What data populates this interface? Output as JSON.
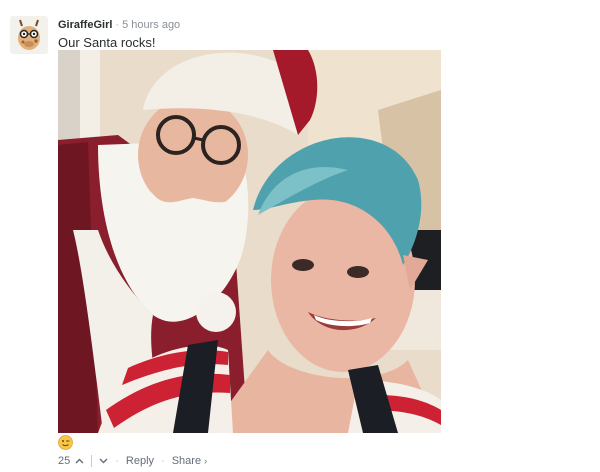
{
  "comment": {
    "author": "GiraffeGirl",
    "separator": "·",
    "timestamp": "5 hours ago",
    "text": "Our Santa rocks!",
    "reaction_icon": "winking-face-emoji",
    "votes": "25",
    "actions": {
      "upvote_icon": "chevron-up-icon",
      "downvote_icon": "chevron-down-icon",
      "reply_label": "Reply",
      "share_label": "Share",
      "share_chevron": "›",
      "dot": "·"
    }
  },
  "colors": {
    "author_text": "#2a2e2e",
    "meta_text": "#8b9196",
    "action_text": "#656c7a",
    "santa_red": "#8a1e2c",
    "hair_teal": "#4fa1ad"
  }
}
